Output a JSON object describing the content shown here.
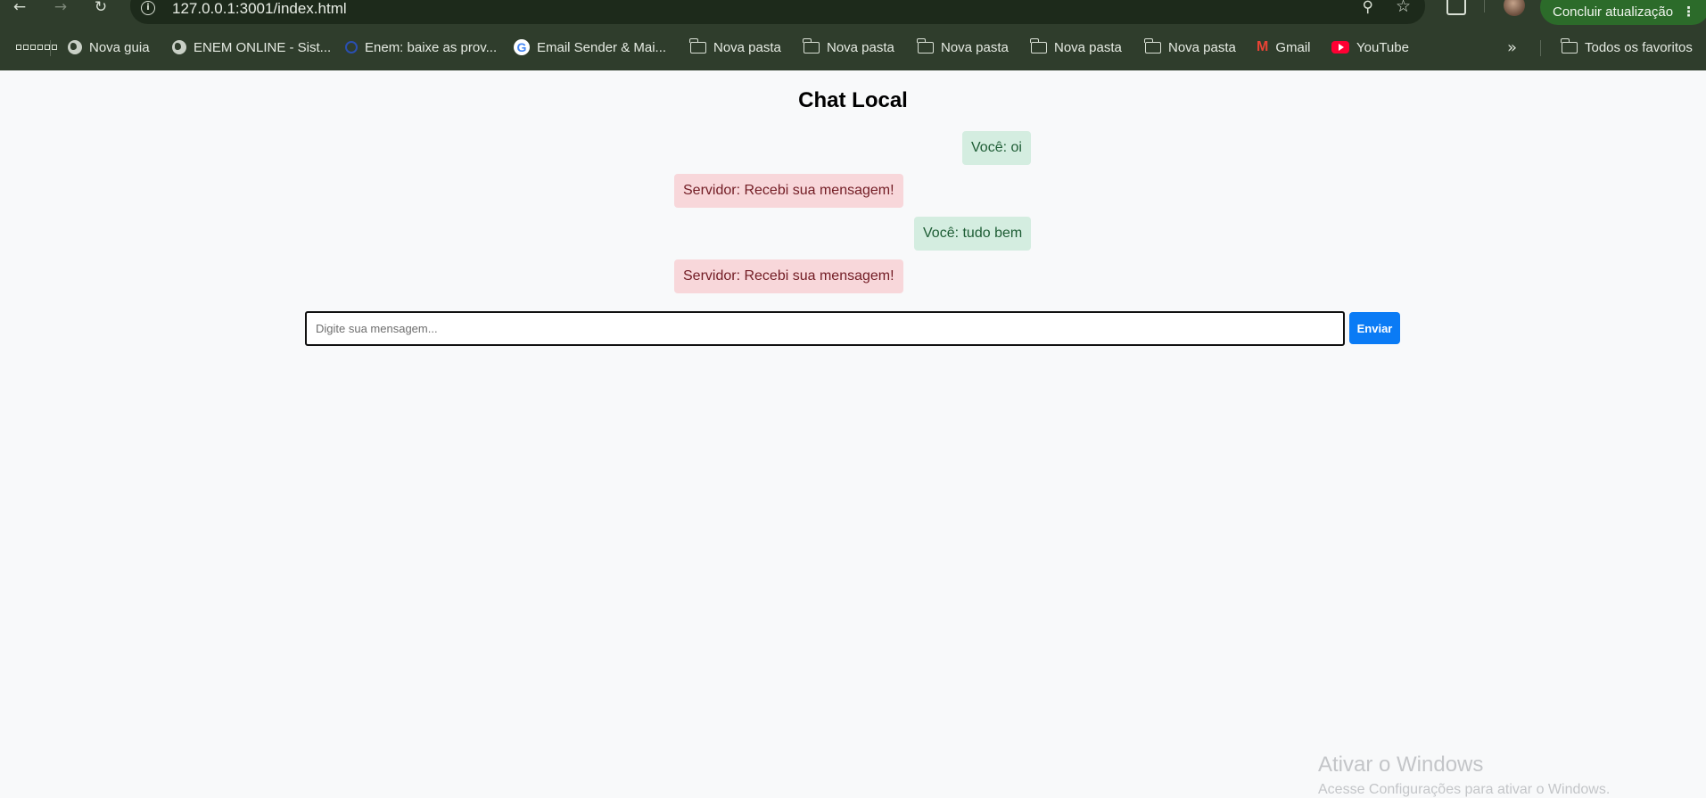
{
  "browser": {
    "url": "127.0.0.1:3001/index.html",
    "update_button_label": "Concluir atualização",
    "bookmarks": [
      {
        "label": "Nova guia",
        "icon": "globe-icon"
      },
      {
        "label": "ENEM ONLINE - Sist...",
        "icon": "globe-icon"
      },
      {
        "label": "Enem: baixe as prov...",
        "icon": "ring-icon"
      },
      {
        "label": "Email Sender & Mai...",
        "icon": "google-icon"
      },
      {
        "label": "Nova pasta",
        "icon": "folder-icon"
      },
      {
        "label": "Nova pasta",
        "icon": "folder-icon"
      },
      {
        "label": "Nova pasta",
        "icon": "folder-icon"
      },
      {
        "label": "Nova pasta",
        "icon": "folder-icon"
      },
      {
        "label": "Nova pasta",
        "icon": "folder-icon"
      },
      {
        "label": "Gmail",
        "icon": "gmail-icon"
      },
      {
        "label": "YouTube",
        "icon": "youtube-icon"
      }
    ],
    "all_bookmarks_label": "Todos os favoritos"
  },
  "chat": {
    "title": "Chat Local",
    "messages": [
      {
        "sender": "user",
        "text": "Você: oi"
      },
      {
        "sender": "server",
        "text": "Servidor: Recebi sua mensagem!"
      },
      {
        "sender": "user",
        "text": "Você: tudo bem"
      },
      {
        "sender": "server",
        "text": "Servidor: Recebi sua mensagem!"
      }
    ],
    "input_placeholder": "Digite sua mensagem...",
    "input_value": "",
    "send_label": "Enviar"
  },
  "watermark": {
    "title": "Ativar o Windows",
    "subtitle": "Acesse Configurações para ativar o Windows."
  },
  "colors": {
    "user_bubble": "#d4ede0",
    "server_bubble": "#f8d7da",
    "send_button": "#0a7bf5",
    "browser_frame": "#2f3d2c"
  }
}
